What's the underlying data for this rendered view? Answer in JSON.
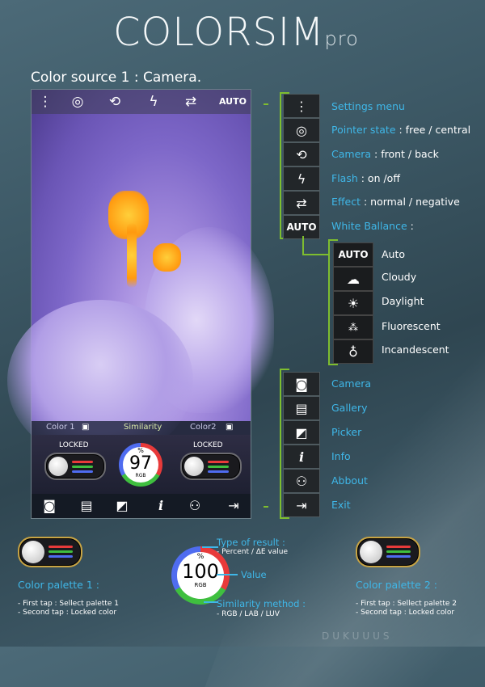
{
  "app_title": {
    "main": "COLORSIM",
    "suffix": "pro"
  },
  "subtitle": "Color source 1 : Camera.",
  "phone": {
    "topbar": {
      "wb_label": "AUTO"
    },
    "similarity_row": {
      "color1": "Color 1",
      "similarity": "Similarity",
      "color2": "Color2"
    },
    "left_toggle": {
      "state": "LOCKED"
    },
    "right_toggle": {
      "state": "LOCKED"
    },
    "gauge": {
      "value": "97",
      "top": "%",
      "bottom": "RGB"
    }
  },
  "menu_items": [
    {
      "icon": "more-vert-icon",
      "label_blue": "Settings menu",
      "label_white": ""
    },
    {
      "icon": "pointer-icon",
      "label_blue": "Pointer state",
      "label_white": " : free / central"
    },
    {
      "icon": "camera-switch-icon",
      "label_blue": "Camera",
      "label_white": "  : front / back"
    },
    {
      "icon": "flash-icon",
      "label_blue": "Flash",
      "label_white": " : on /off"
    },
    {
      "icon": "effect-icon",
      "label_blue": "Effect",
      "label_white": " : normal / negative"
    },
    {
      "icon": "auto-wb-icon",
      "box_text": "AUTO",
      "label_blue": "White Ballance",
      "label_white": " :"
    }
  ],
  "wb_items": [
    {
      "icon": "auto-icon",
      "box_text": "AUTO",
      "label": "Auto"
    },
    {
      "icon": "cloudy-icon",
      "label": "Cloudy"
    },
    {
      "icon": "daylight-icon",
      "label": "Daylight"
    },
    {
      "icon": "fluorescent-icon",
      "label": "Fluorescent"
    },
    {
      "icon": "incandescent-icon",
      "label": "Incandescent"
    }
  ],
  "bottom_items": [
    {
      "icon": "camera-icon",
      "label": "Camera"
    },
    {
      "icon": "gallery-icon",
      "label": "Gallery"
    },
    {
      "icon": "picker-icon",
      "label": "Picker"
    },
    {
      "icon": "info-icon",
      "label": "Info"
    },
    {
      "icon": "about-icon",
      "label": "Abbout"
    },
    {
      "icon": "exit-icon",
      "label": "Exit"
    }
  ],
  "legend": {
    "palette1": {
      "title": "Color palette 1 :",
      "line1": "- First tap : Sellect palette 1",
      "line2": "- Second tap : Locked color"
    },
    "palette2": {
      "title": "Color palette 2 :",
      "line1": "- First tap : Sellect palette 2",
      "line2": "- Second tap : Locked color"
    },
    "gauge": {
      "value": "100",
      "top": "%",
      "bottom": "RGB",
      "type_title": "Type of result :",
      "type_desc": "- Percent / ΔE value",
      "value_label": "Value",
      "method_title": "Similarity method :",
      "method_desc": "- RGB / LAB / LUV"
    }
  },
  "watermark": "DUKUUUS",
  "colors": {
    "accent_blue": "#3fb7e8",
    "bracket_green": "#7ebd2f",
    "red": "#e83a3a",
    "green": "#3fbf3f",
    "blue": "#4f6cf0"
  }
}
